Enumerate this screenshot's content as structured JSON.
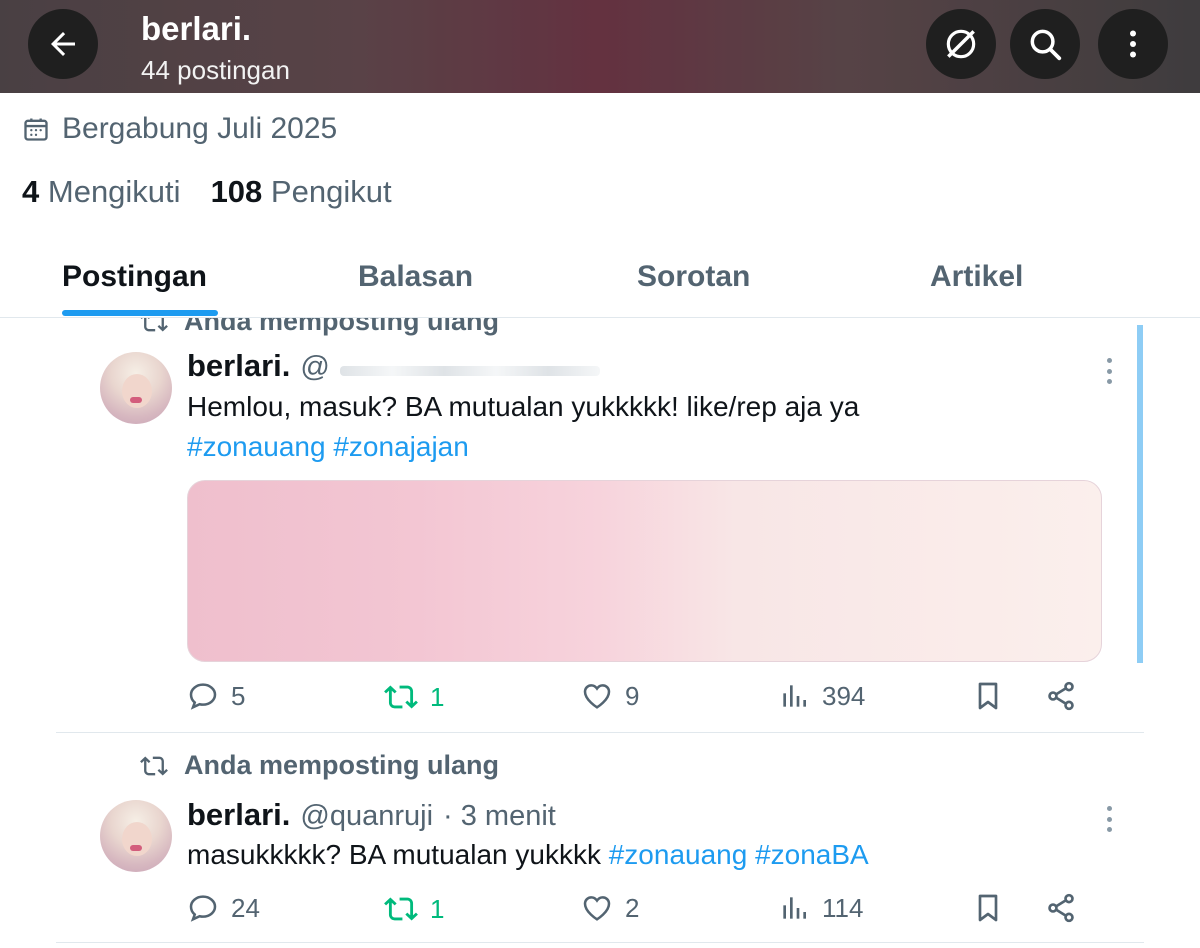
{
  "header": {
    "title": "berlari.",
    "subtitle": "44 postingan"
  },
  "profile": {
    "joined": "Bergabung Juli 2025",
    "following_count": "4",
    "following_label": "Mengikuti",
    "followers_count": "108",
    "followers_label": "Pengikut"
  },
  "tabs": [
    {
      "label": "Postingan",
      "active": true
    },
    {
      "label": "Balasan",
      "active": false
    },
    {
      "label": "Sorotan",
      "active": false
    },
    {
      "label": "Artikel",
      "active": false
    }
  ],
  "posts": [
    {
      "repost_label": "Anda memposting ulang",
      "name": "berlari.",
      "handle": "@",
      "text": "Hemlou, masuk? BA mutualan yukkkkk! like/rep aja ya",
      "hashtags": "#zonauang #zonajajan",
      "replies": "5",
      "reposts": "1",
      "likes": "9",
      "views": "394"
    },
    {
      "repost_label": "Anda memposting ulang",
      "name": "berlari.",
      "handle": "@quanruji",
      "time": "· 3 menit",
      "text": "masukkkkk? BA mutualan yukkkk",
      "hashtags": "#zonauang #zonaBA",
      "replies": "24",
      "reposts": "1",
      "likes": "2",
      "views": "114"
    }
  ],
  "colors": {
    "accent": "#1d9bf0",
    "repost_green": "#00ba7c",
    "muted": "#536471"
  }
}
